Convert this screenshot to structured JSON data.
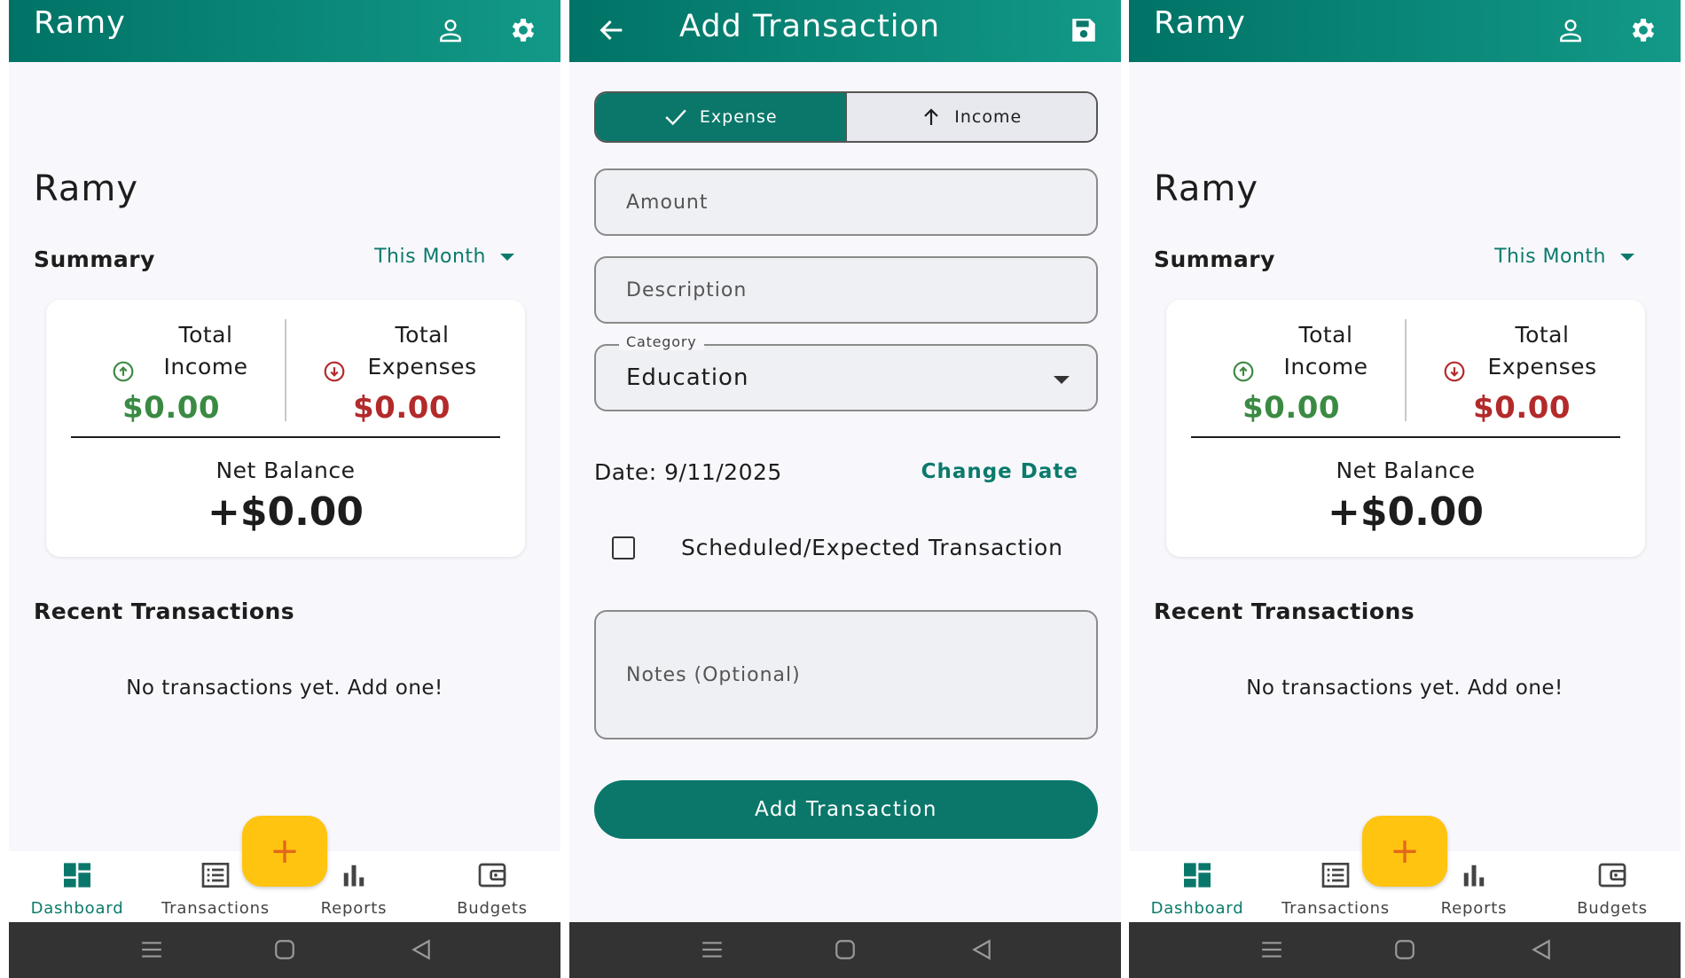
{
  "dashboard": {
    "app_title": "Ramy",
    "user_name": "Ramy",
    "summary_title": "Summary",
    "period": "This Month",
    "total_income_label_1": "Total",
    "total_income_label_2": "Income",
    "total_income_value": "$0.00",
    "total_expenses_label_1": "Total",
    "total_expenses_label_2": "Expenses",
    "total_expenses_value": "$0.00",
    "net_balance_label": "Net Balance",
    "net_balance_value": "+$0.00",
    "recent_title": "Recent Transactions",
    "empty_message": "No transactions yet. Add one!",
    "fab_label": "+",
    "nav": [
      {
        "label": "Dashboard"
      },
      {
        "label": "Transactions"
      },
      {
        "label": "Reports"
      },
      {
        "label": "Budgets"
      }
    ]
  },
  "add_transaction": {
    "title": "Add Transaction",
    "expense_label": "Expense",
    "income_label": "Income",
    "amount_placeholder": "Amount",
    "description_placeholder": "Description",
    "category_label": "Category",
    "category_value": "Education",
    "date_text": "Date: 9/11/2025",
    "change_date_label": "Change Date",
    "scheduled_label": "Scheduled/Expected Transaction",
    "notes_placeholder": "Notes (Optional)",
    "submit_label": "Add Transaction"
  },
  "colors": {
    "primary": "#0a776a",
    "income_green": "#3b8a43",
    "expense_red": "#b32a2a",
    "fab_yellow": "#ffc410",
    "system_bar": "#333333"
  },
  "icons": [
    "person-icon",
    "gear-icon",
    "arrow-back-icon",
    "save-icon",
    "check-icon",
    "arrow-up-icon",
    "income-circle-icon",
    "expense-circle-icon",
    "dashboard-icon",
    "list-icon",
    "bar-chart-icon",
    "wallet-icon",
    "menu-icon",
    "home-square-icon",
    "back-triangle-icon"
  ]
}
